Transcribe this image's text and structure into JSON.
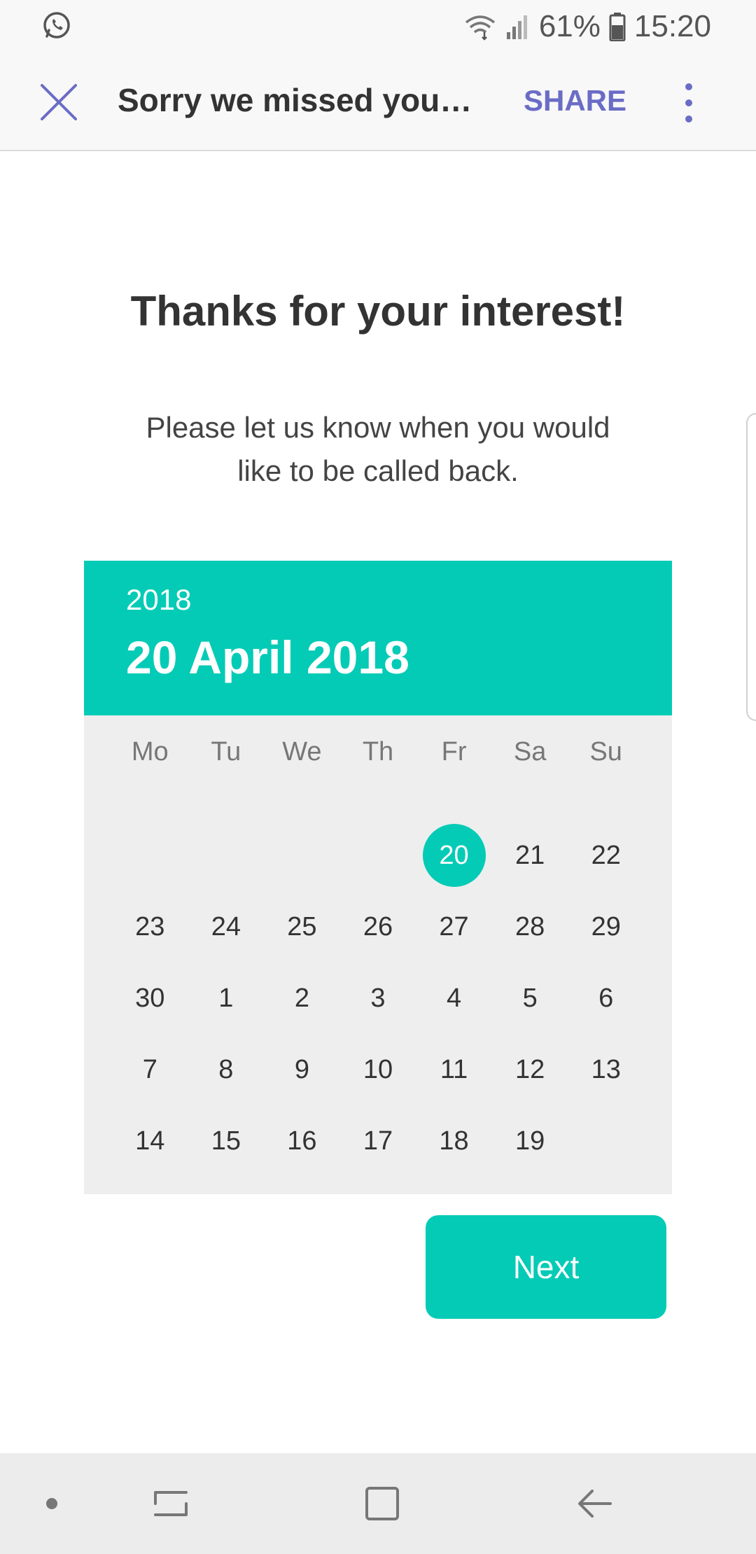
{
  "status_bar": {
    "battery": "61%",
    "time": "15:20",
    "icons": [
      "whatsapp-icon",
      "wifi-icon",
      "signal-icon",
      "battery-icon"
    ]
  },
  "app_bar": {
    "title": "Sorry we missed your c…",
    "share_label": "SHARE",
    "icons": [
      "close-icon",
      "more-vert-icon"
    ]
  },
  "content": {
    "heading": "Thanks for your interest!",
    "subtext": "Please let us know when you would like to be called back."
  },
  "calendar": {
    "year": "2018",
    "selected_date": "20 April 2018",
    "weekdays": [
      "Mo",
      "Tu",
      "We",
      "Th",
      "Fr",
      "Sa",
      "Su"
    ],
    "leading_blanks": 4,
    "days": [
      "20",
      "21",
      "22",
      "23",
      "24",
      "25",
      "26",
      "27",
      "28",
      "29",
      "30",
      "1",
      "2",
      "3",
      "4",
      "5",
      "6",
      "7",
      "8",
      "9",
      "10",
      "11",
      "12",
      "13",
      "14",
      "15",
      "16",
      "17",
      "18",
      "19"
    ],
    "selected": "20"
  },
  "next_label": "Next",
  "colors": {
    "accent": "#04cbb6",
    "share": "#6a6cc6",
    "calendar_bg": "#eeeeee"
  }
}
